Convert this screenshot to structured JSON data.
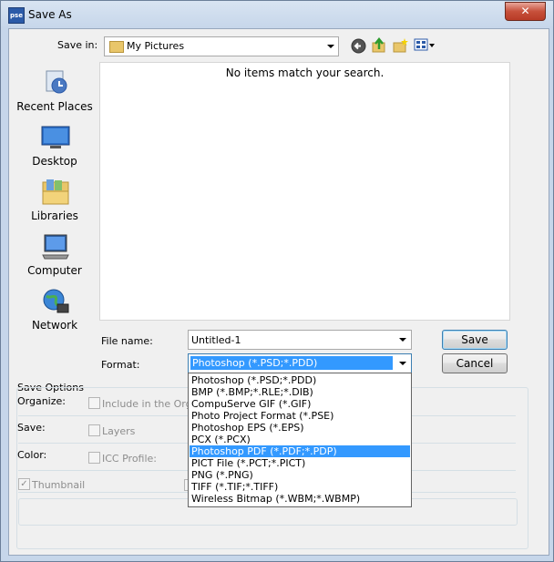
{
  "window": {
    "title": "Save As",
    "app_icon_text": "pse",
    "close_glyph": "✕"
  },
  "toolbar": {
    "save_in_label": "Save in:",
    "save_in_value": "My Pictures",
    "icons": [
      "back-arrow-icon",
      "up-folder-icon",
      "new-folder-icon",
      "view-menu-icon"
    ]
  },
  "places": [
    {
      "label": "Recent Places",
      "icon": "recent-places-icon"
    },
    {
      "label": "Desktop",
      "icon": "desktop-icon"
    },
    {
      "label": "Libraries",
      "icon": "libraries-icon"
    },
    {
      "label": "Computer",
      "icon": "computer-icon"
    },
    {
      "label": "Network",
      "icon": "network-icon"
    }
  ],
  "file_list": {
    "empty_message": "No items match your search."
  },
  "file_name": {
    "label": "File name:",
    "value": "Untitled-1"
  },
  "format": {
    "label": "Format:",
    "selected": "Photoshop (*.PSD;*.PDD)",
    "options": [
      "Photoshop (*.PSD;*.PDD)",
      "BMP (*.BMP;*.RLE;*.DIB)",
      "CompuServe GIF (*.GIF)",
      "Photo Project Format (*.PSE)",
      "Photoshop EPS (*.EPS)",
      "PCX (*.PCX)",
      "Photoshop PDF (*.PDF;*.PDP)",
      "PICT File (*.PCT;*.PICT)",
      "PNG (*.PNG)",
      "TIFF (*.TIF;*.TIFF)",
      "Wireless Bitmap (*.WBM;*.WBMP)"
    ],
    "highlighted": "Photoshop PDF (*.PDF;*.PDP)"
  },
  "buttons": {
    "save": "Save",
    "cancel": "Cancel"
  },
  "save_options": {
    "title": "Save Options",
    "organize_label": "Organize:",
    "include_in_organizer": "Include in the Org",
    "save_label": "Save:",
    "layers": "Layers",
    "color_label": "Color:",
    "icc_profile": "ICC Profile:",
    "thumbnail": "Thumbnail",
    "thumbnail_checked": true
  },
  "colors": {
    "accent": "#3399ff",
    "close": "#c7503b"
  }
}
